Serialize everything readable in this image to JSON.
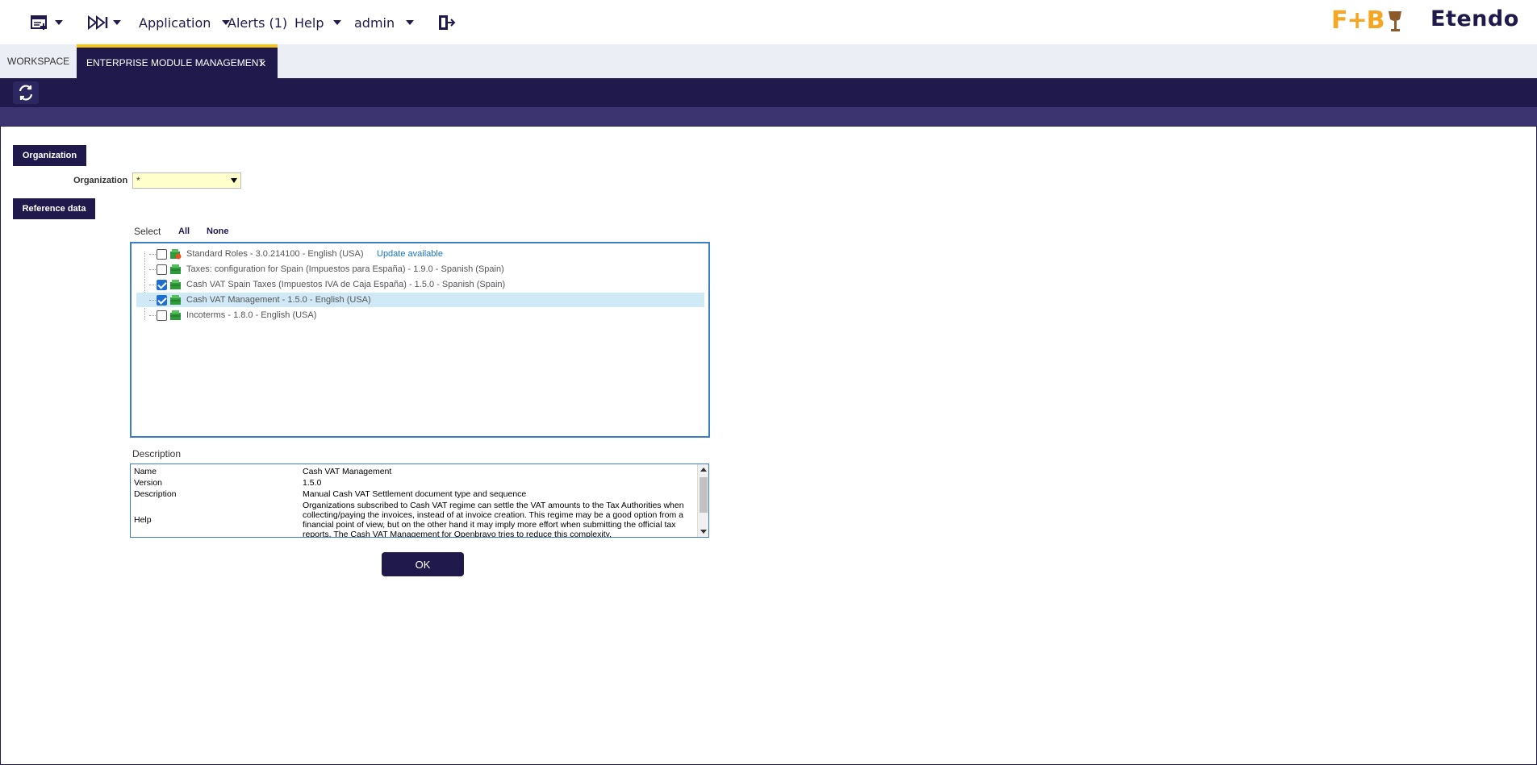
{
  "nav": {
    "application_label": "Application",
    "alerts_label": "Alerts (1)",
    "help_label": "Help",
    "user_label": "admin"
  },
  "brand": {
    "logo_text": "F+B",
    "name": "Etendo"
  },
  "tabs": {
    "workspace": "WORKSPACE",
    "active": "ENTERPRISE MODULE MANAGEMENT",
    "close_glyph": "×"
  },
  "form": {
    "organization_section": "Organization",
    "organization_label": "Organization",
    "organization_value": "*",
    "reference_section": "Reference data",
    "select_label": "Select",
    "select_all": "All",
    "select_none": "None"
  },
  "modules": [
    {
      "label": "Standard Roles - 3.0.214100 - English (USA)",
      "checked": false,
      "selected": false,
      "icon": "package-update-icon",
      "update": "Update available"
    },
    {
      "label": "Taxes: configuration for Spain (Impuestos para España) - 1.9.0 - Spanish (Spain)",
      "checked": false,
      "selected": false,
      "icon": "package-icon"
    },
    {
      "label": "Cash VAT Spain Taxes (Impuestos IVA de Caja España) - 1.5.0 - Spanish (Spain)",
      "checked": true,
      "selected": false,
      "icon": "package-icon"
    },
    {
      "label": "Cash VAT Management - 1.5.0 - English (USA)",
      "checked": true,
      "selected": true,
      "icon": "package-icon"
    },
    {
      "label": "Incoterms - 1.8.0 - English (USA)",
      "checked": false,
      "selected": false,
      "icon": "package-icon"
    }
  ],
  "description": {
    "title": "Description",
    "rows": [
      {
        "key": "Name",
        "value": "Cash VAT Management"
      },
      {
        "key": "Version",
        "value": "1.5.0"
      },
      {
        "key": "Description",
        "value": "Manual Cash VAT Settlement document type and sequence"
      },
      {
        "key": "Help",
        "value": "Organizations subscribed to Cash VAT regime can settle the VAT amounts to the Tax Authorities when collecting/paying the invoices, instead of at invoice creation. This regime may be a good option from a financial point of view, but on the other hand it may imply more effort when submitting the official tax reports. The Cash VAT Management for Openbravo tries to reduce this complexity."
      }
    ]
  },
  "actions": {
    "ok_label": "OK"
  },
  "colors": {
    "brand_navy": "#1f1a4b",
    "accent_yellow": "#f5c518",
    "link_blue": "#1a73c9",
    "selected_row": "#cfe9f7"
  }
}
